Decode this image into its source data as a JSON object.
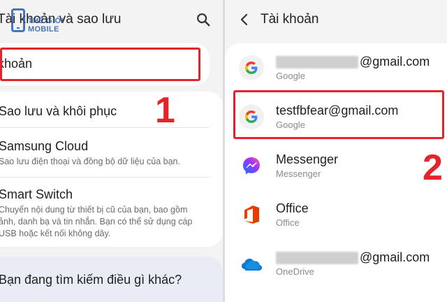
{
  "left": {
    "title": "Tài khoản và sao lưu",
    "watermark": "THẾ GIỚI MOBILE",
    "account_item": "khoản",
    "items": [
      {
        "title": "Sao lưu và khôi phục",
        "subtitle": ""
      },
      {
        "title": "Samsung Cloud",
        "subtitle": "Sao lưu điện thoại và đồng bộ dữ liệu của bạn."
      },
      {
        "title": "Smart Switch",
        "subtitle": "Chuyển nội dung từ thiết bị cũ của bạn, bao gồm ảnh, danh bạ và tin nhắn. Bạn có thể sử dụng cáp USB hoặc kết nối không dây."
      }
    ],
    "question": "Bạn đang tìm kiếm điều gì khác?",
    "step_number": "1"
  },
  "right": {
    "title": "Tài khoản",
    "accounts": [
      {
        "name": "@gmail.com",
        "type": "Google",
        "icon": "google-icon",
        "redacted": true
      },
      {
        "name": "testfbfear@gmail.com",
        "type": "Google",
        "icon": "google-icon",
        "redacted": false
      },
      {
        "name": "Messenger",
        "type": "Messenger",
        "icon": "messenger-icon",
        "redacted": false
      },
      {
        "name": "Office",
        "type": "Office",
        "icon": "office-icon",
        "redacted": false
      },
      {
        "name": "@gmail.com",
        "type": "OneDrive",
        "icon": "onedrive-icon",
        "redacted": true
      }
    ],
    "step_number": "2"
  },
  "colors": {
    "highlight": "#e3242b",
    "background": "#f3f3f3",
    "card": "#ffffff",
    "suggestion_card": "#e7ecf5"
  }
}
